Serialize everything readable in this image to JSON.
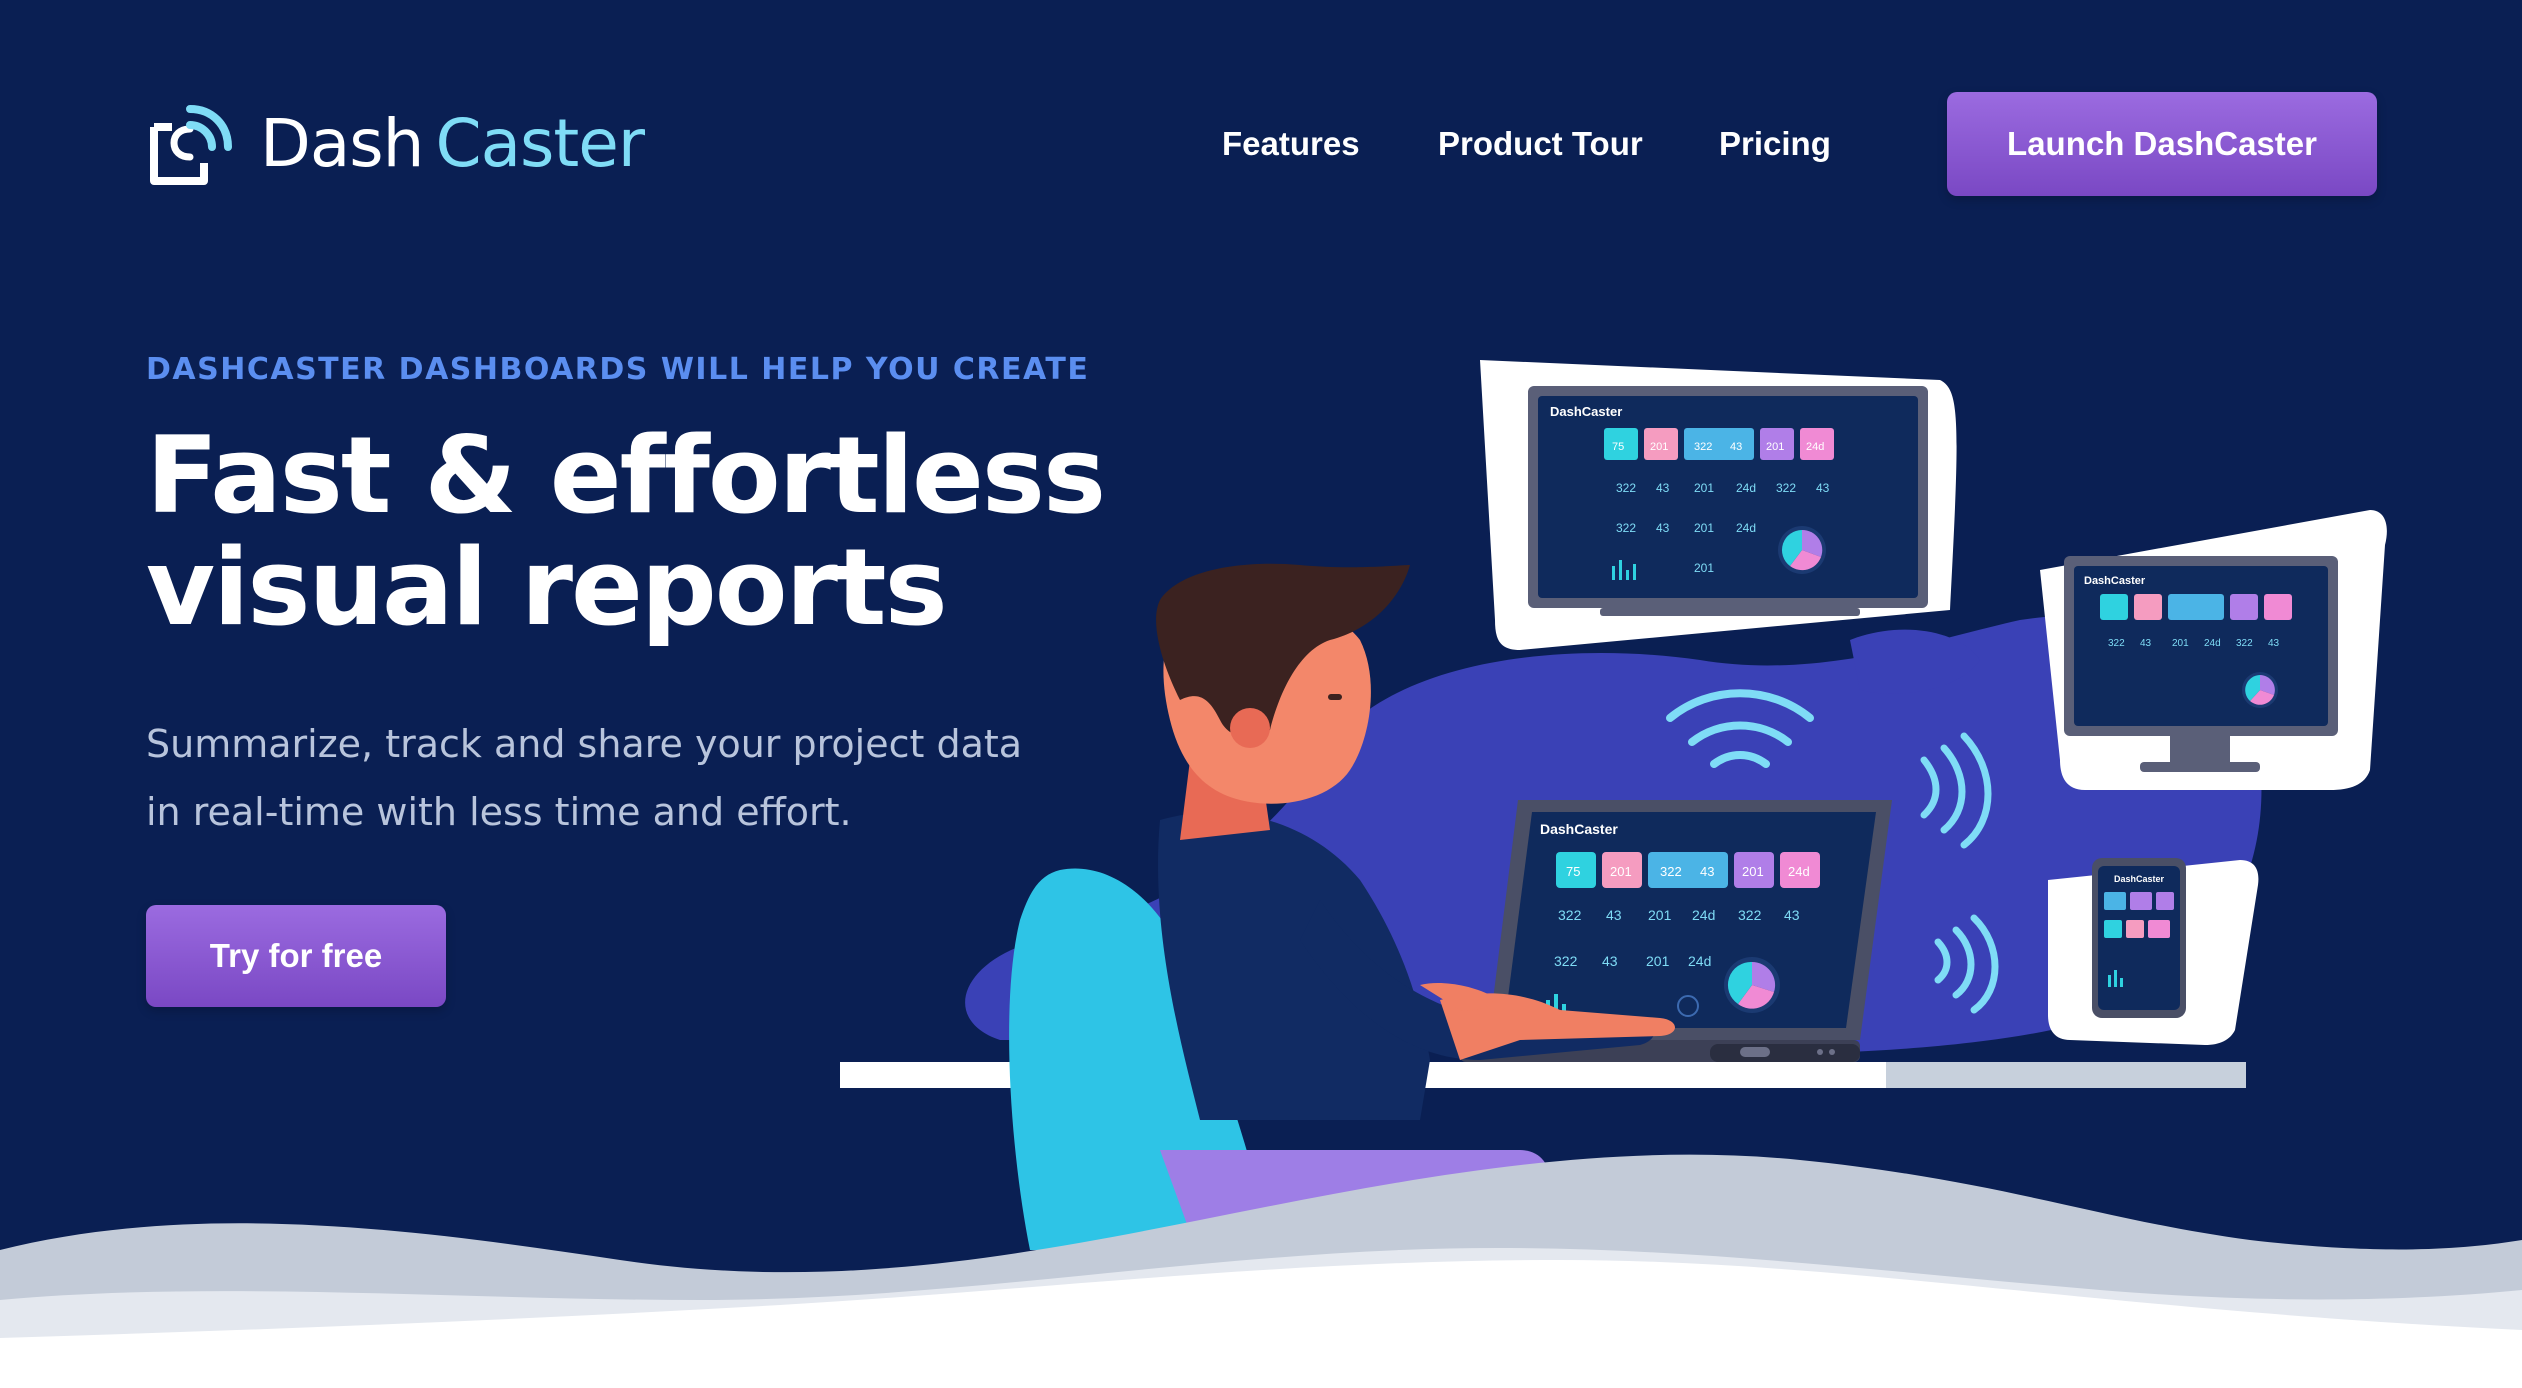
{
  "brand": {
    "name_part1": "Dash",
    "name_part2": "Caster"
  },
  "nav": {
    "links": [
      {
        "label": "Features"
      },
      {
        "label": "Product Tour"
      },
      {
        "label": "Pricing"
      }
    ],
    "cta_label": "Launch DashCaster"
  },
  "hero": {
    "eyebrow": "DASHCASTER DASHBOARDS WILL HELP YOU CREATE",
    "headline_line1": "Fast & effortless",
    "headline_line2": "visual reports",
    "subtitle_line1": "Summarize, track and share your project data",
    "subtitle_line2": "in real-time with less time and effort.",
    "cta_label": "Try for free"
  },
  "illustration": {
    "screen_brand": "DashCaster",
    "tiles": [
      "75",
      "201",
      "322",
      "43",
      "201",
      "24d"
    ],
    "stats": [
      "322",
      "43",
      "201",
      "24d",
      "322",
      "43",
      "201",
      "24d",
      "201"
    ],
    "colors": {
      "background": "#0a1f53",
      "accent_purple": "#8a5bd6",
      "accent_cyan": "#7fdcf6",
      "tile_cyan": "#2fd2e0",
      "tile_pink": "#f59cc0",
      "tile_purple": "#b07ee8"
    }
  }
}
